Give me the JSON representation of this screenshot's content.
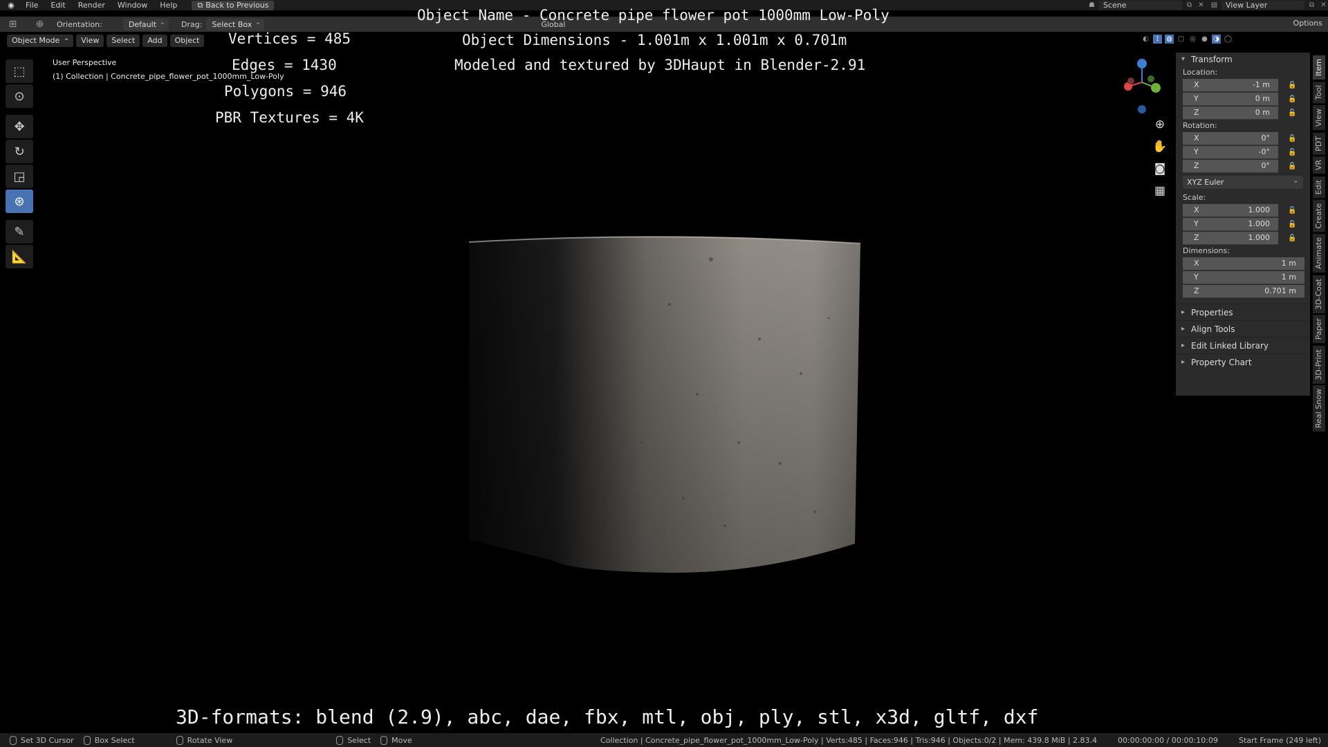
{
  "menubar": {
    "items": [
      "File",
      "Edit",
      "Render",
      "Window",
      "Help"
    ],
    "back_button": "Back to Previous",
    "scene_label": "Scene",
    "view_layer_label": "View Layer"
  },
  "header": {
    "orientation_label": "Orientation:",
    "orientation_value": "Default",
    "drag_label": "Drag:",
    "drag_value": "Select Box",
    "transform_global": "Global",
    "options": "Options"
  },
  "modebar": {
    "mode": "Object Mode",
    "view": "View",
    "select": "Select",
    "add": "Add",
    "object": "Object"
  },
  "viewport": {
    "perspective": "User Perspective",
    "collection": "(1) Collection | Concrete_pipe_flower_pot_1000mm_Low-Poly"
  },
  "overlay": {
    "vertices": "Vertices = 485",
    "edges": "Edges = 1430",
    "polygons": "Polygons = 946",
    "textures": "PBR Textures = 4K",
    "object_name": "Object Name - Concrete pipe flower pot 1000mm Low-Poly",
    "object_dims": "Object Dimensions -  1.001m x 1.001m x 0.701m",
    "modeled_by": "Modeled and textured by 3DHaupt in Blender-2.91",
    "formats": "3D-formats: blend (2.9), abc, dae, fbx, mtl, obj, ply, stl, x3d, gltf, dxf"
  },
  "npanel": {
    "transform": "Transform",
    "location_label": "Location:",
    "location": [
      {
        "axis": "X",
        "value": "-1 m"
      },
      {
        "axis": "Y",
        "value": "0 m"
      },
      {
        "axis": "Z",
        "value": "0 m"
      }
    ],
    "rotation_label": "Rotation:",
    "rotation": [
      {
        "axis": "X",
        "value": "0°"
      },
      {
        "axis": "Y",
        "value": "-0°"
      },
      {
        "axis": "Z",
        "value": "0°"
      }
    ],
    "rotation_mode": "XYZ Euler",
    "scale_label": "Scale:",
    "scale": [
      {
        "axis": "X",
        "value": "1.000"
      },
      {
        "axis": "Y",
        "value": "1.000"
      },
      {
        "axis": "Z",
        "value": "1.000"
      }
    ],
    "dimensions_label": "Dimensions:",
    "dimensions": [
      {
        "axis": "X",
        "value": "1 m"
      },
      {
        "axis": "Y",
        "value": "1 m"
      },
      {
        "axis": "Z",
        "value": "0.701 m"
      }
    ],
    "collapsed": [
      "Properties",
      "Align Tools",
      "Edit Linked Library",
      "Property Chart"
    ]
  },
  "vtabs": [
    "Item",
    "Tool",
    "View",
    "PDT",
    "VR",
    "Edit",
    "Create",
    "Animate",
    "3D-Coat",
    "Paper",
    "3D-Print",
    "Real Snow"
  ],
  "statusbar": {
    "set_cursor": "Set 3D Cursor",
    "box_select": "Box Select",
    "rotate_view": "Rotate View",
    "select": "Select",
    "move": "Move",
    "stats": "Collection | Concrete_pipe_flower_pot_1000mm_Low-Poly | Verts:485 | Faces:946 | Tris:946 | Objects:0/2 | Mem: 439.8 MiB | 2.83.4",
    "time": "00:00:00:00 / 00:00:10:09",
    "frame": "Start Frame (249 left)"
  },
  "colors": {
    "active_tool": "#4772b3",
    "gizmo_x": "#e04848",
    "gizmo_y": "#6cb33a",
    "gizmo_z": "#3e7fd6"
  }
}
